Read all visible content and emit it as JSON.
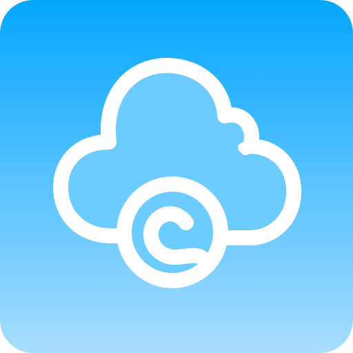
{
  "icon": {
    "name": "cloud-app-icon",
    "colors": {
      "gradient_top": "#04A6FD",
      "gradient_bottom": "#A7DDFF",
      "cloud_fill": "#6CCBFF",
      "outline": "#FFFFFF"
    }
  }
}
